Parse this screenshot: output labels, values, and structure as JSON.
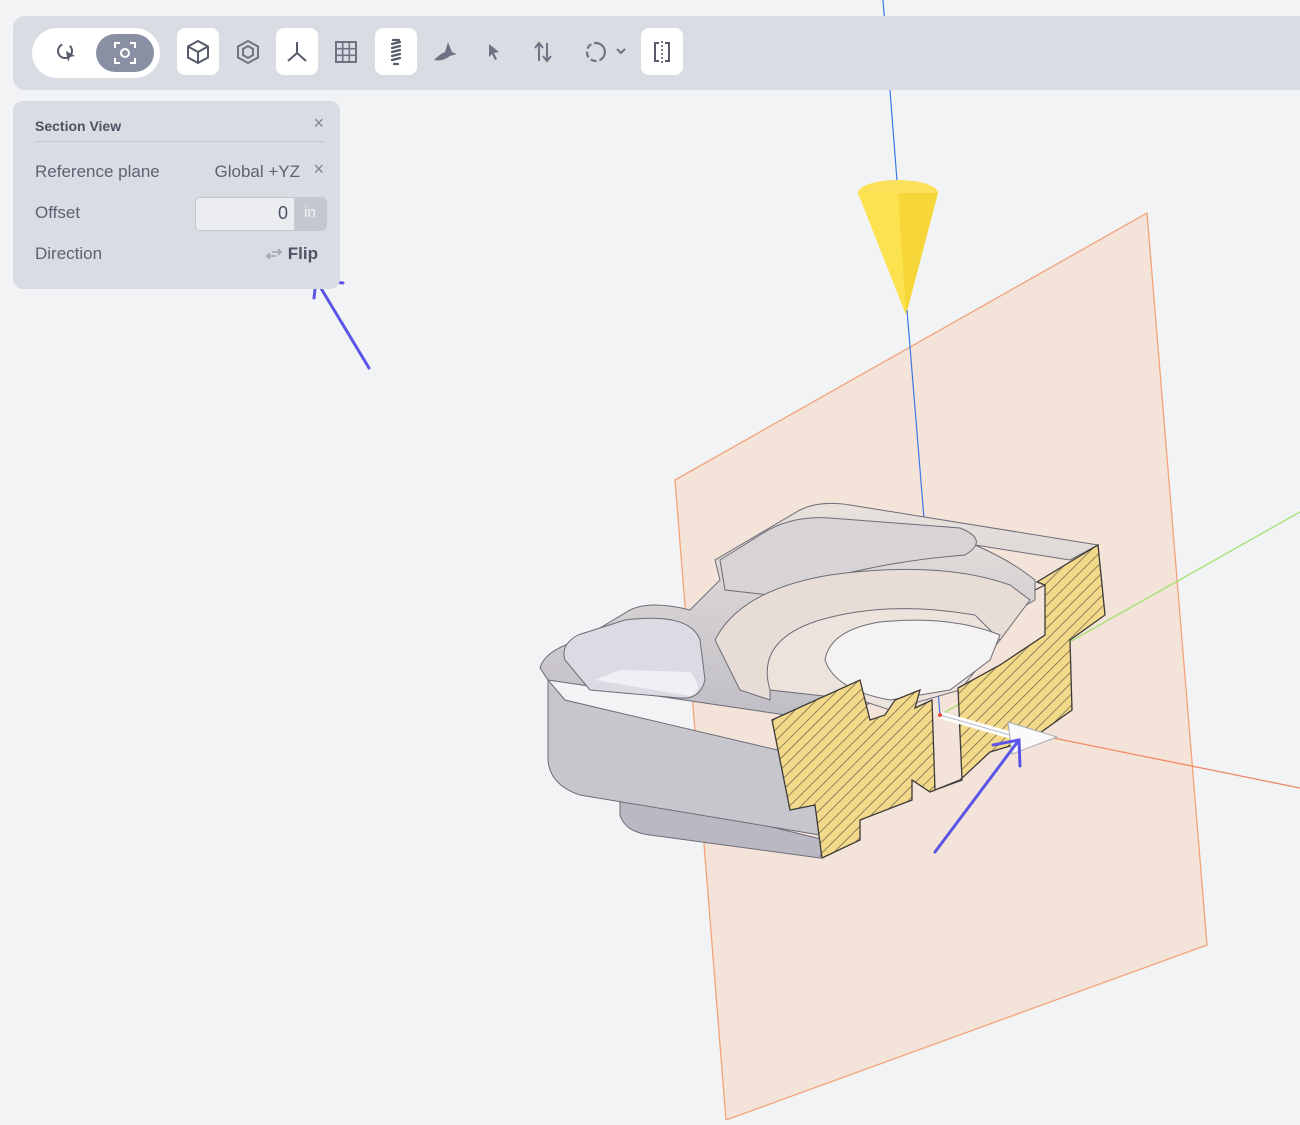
{
  "toolbar": {
    "mode_buttons": [
      {
        "icon": "select-cursor-icon"
      },
      {
        "icon": "focus-target-icon",
        "active": true
      }
    ],
    "tools": [
      {
        "icon": "cube-icon",
        "active": true
      },
      {
        "icon": "isometric-cube-icon",
        "active": false
      },
      {
        "icon": "axes-icon",
        "active": true
      },
      {
        "icon": "grid-icon",
        "active": false
      },
      {
        "icon": "thread-icon",
        "active": true
      },
      {
        "icon": "bird-icon",
        "active": false
      },
      {
        "icon": "pointer-icon",
        "active": false
      },
      {
        "icon": "swap-vertical-icon",
        "active": false
      },
      {
        "icon": "orbit-dropdown-icon",
        "active": false
      },
      {
        "icon": "section-view-icon",
        "active": true
      }
    ]
  },
  "section_panel": {
    "title": "Section View",
    "reference_plane_label": "Reference plane",
    "reference_plane_value": "Global +YZ",
    "offset_label": "Offset",
    "offset_value": "0",
    "offset_unit": "in",
    "direction_label": "Direction",
    "flip_label": "Flip"
  },
  "colors": {
    "background": "#f2f3f5",
    "toolbar": "#d9dce3",
    "section_plane": "#f5d9c4",
    "cut_face": "#f3d98a",
    "cone": "#fde24f",
    "annotation_arrow": "#5a55e6"
  }
}
